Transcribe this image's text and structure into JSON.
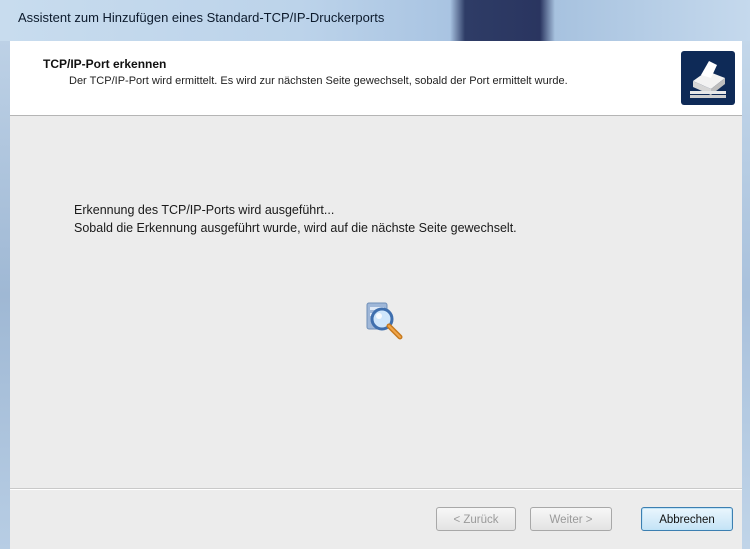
{
  "window": {
    "title": "Assistent zum Hinzufügen eines Standard-TCP/IP-Druckerports"
  },
  "header": {
    "title": "TCP/IP-Port erkennen",
    "subtitle": "Der TCP/IP-Port wird ermittelt. Es wird zur nächsten Seite gewechselt, sobald der Port ermittelt wurde.",
    "icon": "printer-port-icon"
  },
  "main": {
    "line1": "Erkennung des TCP/IP-Ports wird ausgeführt...",
    "line2": "Sobald die Erkennung ausgeführt wurde, wird auf die nächste Seite gewechselt.",
    "animation_icon": "search-magnifier-icon"
  },
  "footer": {
    "back_label": "< Zurück",
    "next_label": "Weiter >",
    "cancel_label": "Abbrechen",
    "back_enabled": false,
    "next_enabled": false
  }
}
